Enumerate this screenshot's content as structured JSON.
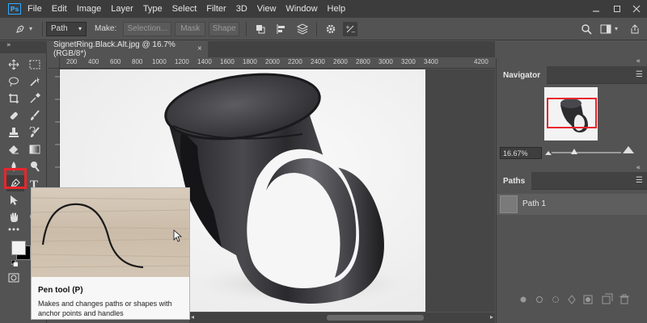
{
  "app": {
    "logo": "Ps"
  },
  "menu": [
    "File",
    "Edit",
    "Image",
    "Layer",
    "Type",
    "Select",
    "Filter",
    "3D",
    "View",
    "Window",
    "Help"
  ],
  "options": {
    "mode": "Path",
    "make_label": "Make:",
    "selection_label": "Selection...",
    "mask_label": "Mask",
    "shape_label": "Shape"
  },
  "document": {
    "tab_title": "SignetRing.Black.Alt.jpg @ 16.7% (RGB/8*)",
    "close_glyph": "×"
  },
  "ruler": {
    "labels": [
      "200",
      "400",
      "600",
      "800",
      "1000",
      "1200",
      "1400",
      "1600",
      "1800",
      "2000",
      "2200",
      "2400",
      "2600",
      "2800",
      "3000",
      "3200",
      "3400",
      "4200"
    ]
  },
  "tooltip": {
    "title": "Pen tool (P)",
    "description": "Makes and changes paths or shapes with anchor points and handles"
  },
  "navigator": {
    "title": "Navigator",
    "zoom": "16.67%",
    "zoom_fraction": 0.33
  },
  "paths": {
    "title": "Paths",
    "items": [
      {
        "name": "Path 1"
      }
    ]
  },
  "colors": {
    "highlight": "#e8262c",
    "accent": "#31a8ff"
  }
}
